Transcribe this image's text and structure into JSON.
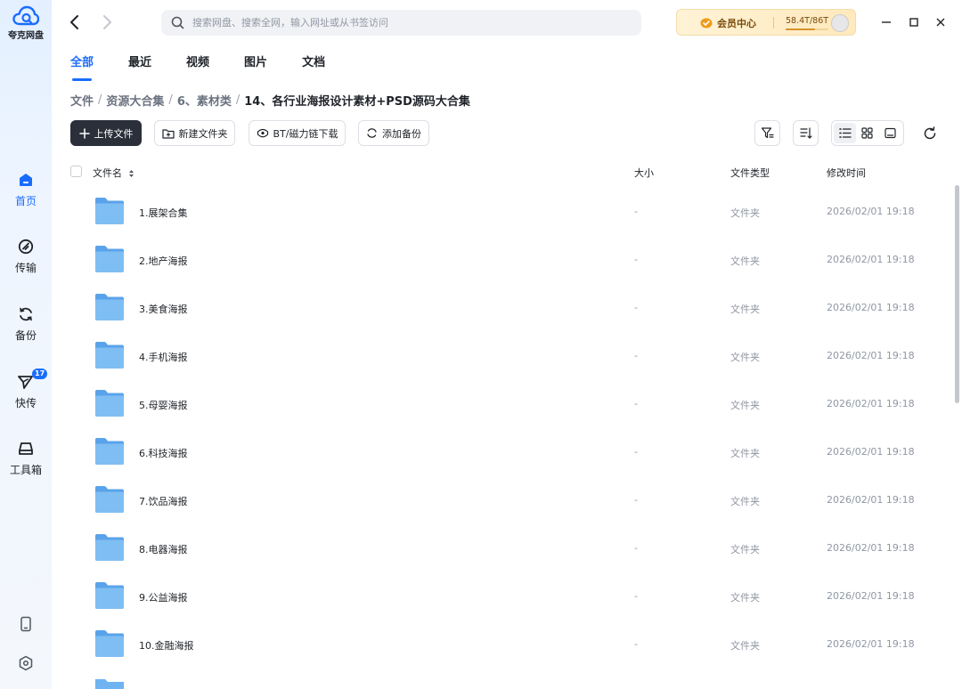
{
  "app": {
    "name": "夸克网盘"
  },
  "sidebar": {
    "items": [
      {
        "label": "首页",
        "icon": "home-icon",
        "active": true
      },
      {
        "label": "传输",
        "icon": "transfer-icon"
      },
      {
        "label": "备份",
        "icon": "backup-icon"
      },
      {
        "label": "快传",
        "icon": "send-icon",
        "badge": "17"
      },
      {
        "label": "工具箱",
        "icon": "toolbox-icon"
      }
    ],
    "bottom": [
      {
        "icon": "phone-icon"
      },
      {
        "icon": "settings-icon"
      }
    ]
  },
  "topbar": {
    "search_placeholder": "搜索网盘、搜索全网，输入网址或从书签访问",
    "vip": {
      "label": "会员中心",
      "storage": "58.4T/86T",
      "usage_fraction": 0.68
    }
  },
  "tabs": [
    {
      "label": "全部",
      "active": true
    },
    {
      "label": "最近"
    },
    {
      "label": "视频"
    },
    {
      "label": "图片"
    },
    {
      "label": "文档"
    }
  ],
  "breadcrumb": [
    "文件",
    "资源大合集",
    "6、素材类",
    "14、各行业海报设计素材+PSD源码大合集"
  ],
  "toolbar": {
    "upload": "上传文件",
    "new_folder": "新建文件夹",
    "bt_download": "BT/磁力链下载",
    "add_backup": "添加备份"
  },
  "table": {
    "columns": {
      "name": "文件名",
      "size": "大小",
      "type": "文件类型",
      "modified": "修改时间"
    },
    "rows": [
      {
        "name": "1.展架合集",
        "size": "-",
        "type": "文件夹",
        "modified": "2026/02/01 19:18"
      },
      {
        "name": "2.地产海报",
        "size": "-",
        "type": "文件夹",
        "modified": "2026/02/01 19:18"
      },
      {
        "name": "3.美食海报",
        "size": "-",
        "type": "文件夹",
        "modified": "2026/02/01 19:18"
      },
      {
        "name": "4.手机海报",
        "size": "-",
        "type": "文件夹",
        "modified": "2026/02/01 19:18"
      },
      {
        "name": "5.母婴海报",
        "size": "-",
        "type": "文件夹",
        "modified": "2026/02/01 19:18"
      },
      {
        "name": "6.科技海报",
        "size": "-",
        "type": "文件夹",
        "modified": "2026/02/01 19:18"
      },
      {
        "name": "7.饮品海报",
        "size": "-",
        "type": "文件夹",
        "modified": "2026/02/01 19:18"
      },
      {
        "name": "8.电器海报",
        "size": "-",
        "type": "文件夹",
        "modified": "2026/02/01 19:18"
      },
      {
        "name": "9.公益海报",
        "size": "-",
        "type": "文件夹",
        "modified": "2026/02/01 19:18"
      },
      {
        "name": "10.金融海报",
        "size": "-",
        "type": "文件夹",
        "modified": "2026/02/01 19:18"
      }
    ]
  },
  "colors": {
    "accent": "#1a6cff",
    "primary_button": "#2b2f3a",
    "folder": "#6fb3f0",
    "muted_text": "#9097a3"
  }
}
